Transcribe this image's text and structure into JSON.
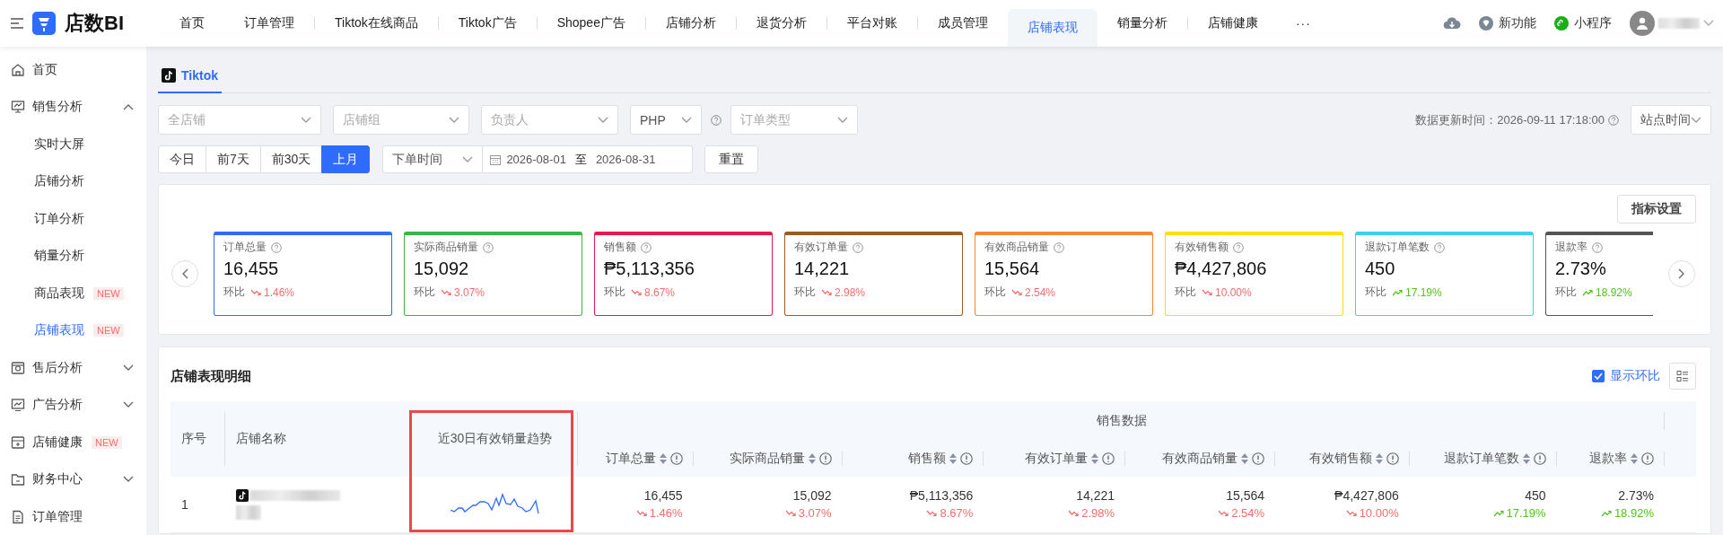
{
  "app": {
    "logo": "店数BI"
  },
  "nav": [
    {
      "label": "首页",
      "selected": false
    },
    {
      "label": "订单管理",
      "selected": false
    },
    {
      "label": "Tiktok在线商品",
      "selected": false
    },
    {
      "label": "Tiktok广告",
      "selected": false
    },
    {
      "label": "Shopee广告",
      "selected": false
    },
    {
      "label": "店铺分析",
      "selected": false
    },
    {
      "label": "退货分析",
      "selected": false
    },
    {
      "label": "平台对账",
      "selected": false
    },
    {
      "label": "成员管理",
      "selected": false
    },
    {
      "label": "店铺表现",
      "selected": true
    },
    {
      "label": "销量分析",
      "selected": false
    },
    {
      "label": "店铺健康",
      "selected": false
    }
  ],
  "nav_more": "···",
  "header_actions": [
    {
      "kind": "download"
    },
    {
      "kind": "features",
      "label": "新功能"
    },
    {
      "kind": "miniapp",
      "label": "小程序"
    }
  ],
  "sidebar": {
    "items": [
      {
        "kind": "home",
        "label": "首页",
        "selected": false
      },
      {
        "kind": "board",
        "label": "销售分析",
        "selected": false,
        "expanded": true,
        "children": [
          {
            "label": "实时大屏",
            "selected": false
          },
          {
            "label": "店铺分析",
            "selected": false
          },
          {
            "label": "订单分析",
            "selected": false
          },
          {
            "label": "销量分析",
            "selected": false
          },
          {
            "label": "商品表现",
            "selected": false,
            "badge": "NEW"
          },
          {
            "label": "店铺表现",
            "selected": true,
            "badge": "NEW"
          }
        ]
      },
      {
        "kind": "aftersale",
        "label": "售后分析",
        "selected": false,
        "expanded": false
      },
      {
        "kind": "ad",
        "label": "广告分析",
        "selected": false,
        "expanded": false
      },
      {
        "kind": "store",
        "label": "店铺健康",
        "selected": false,
        "badge": "NEW"
      },
      {
        "kind": "finance",
        "label": "财务中心",
        "selected": false,
        "expanded": false
      },
      {
        "kind": "document",
        "label": "订单管理",
        "selected": false
      }
    ]
  },
  "platform_tabs": [
    {
      "label": "Tiktok",
      "selected": true
    }
  ],
  "filters": [
    {
      "placeholder": "全店铺"
    },
    {
      "placeholder": "店铺组"
    },
    {
      "placeholder": "负责人"
    }
  ],
  "currency": {
    "value": "PHP"
  },
  "order_type": {
    "placeholder": "订单类型"
  },
  "update_time": "数据更新时间：2026-09-11 17:18:00",
  "timezone": {
    "value": "站点时间"
  },
  "quick_ranges": [
    {
      "label": "今日",
      "selected": false
    },
    {
      "label": "前7天",
      "selected": false
    },
    {
      "label": "前30天",
      "selected": false
    },
    {
      "label": "上月",
      "selected": true
    }
  ],
  "date_filter": {
    "type": "下单时间",
    "start": "2026-08-01",
    "separator": "至",
    "end": "2026-08-31"
  },
  "reset_button": "重置",
  "metrics_button": "指标设置",
  "cards": [
    {
      "label": "订单总量",
      "value": "16,455",
      "compare_label": "环比",
      "change": "1.46%",
      "rising": false,
      "color": "#2f6bff"
    },
    {
      "label": "实际商品销量",
      "value": "15,092",
      "compare_label": "环比",
      "change": "3.07%",
      "rising": false,
      "color": "#3bb346"
    },
    {
      "label": "销售额",
      "value": "₱5,113,356",
      "compare_label": "环比",
      "change": "8.67%",
      "rising": false,
      "color": "#e8194a"
    },
    {
      "label": "有效订单量",
      "value": "14,221",
      "compare_label": "环比",
      "change": "2.98%",
      "rising": false,
      "color": "#9a5c1f"
    },
    {
      "label": "有效商品销量",
      "value": "15,564",
      "compare_label": "环比",
      "change": "2.54%",
      "rising": false,
      "color": "#f58634"
    },
    {
      "label": "有效销售额",
      "value": "₱4,427,806",
      "compare_label": "环比",
      "change": "10.00%",
      "rising": false,
      "color": "#ffdf00"
    },
    {
      "label": "退款订单笔数",
      "value": "450",
      "compare_label": "环比",
      "change": "17.19%",
      "rising": true,
      "color": "#3ad0f0"
    },
    {
      "label": "退款率",
      "value": "2.73%",
      "compare_label": "环比",
      "change": "18.92%",
      "rising": true,
      "color": "#555555"
    }
  ],
  "table": {
    "title": "店铺表现明细",
    "show_compare": {
      "label": "显示环比",
      "checked": true
    },
    "fixed_columns": [
      "序号",
      "店铺名称",
      "近30日有效销量趋势"
    ],
    "group_header": "销售数据",
    "columns": [
      "订单总量",
      "实际商品销量",
      "销售额",
      "有效订单量",
      "有效商品销量",
      "有效销售额",
      "退款订单笔数",
      "退款率"
    ],
    "rows": [
      {
        "index": "1",
        "cells": [
          {
            "value": "16,455",
            "change": "1.46%",
            "rising": false
          },
          {
            "value": "15,092",
            "change": "3.07%",
            "rising": false
          },
          {
            "value": "₱5,113,356",
            "change": "8.67%",
            "rising": false
          },
          {
            "value": "14,221",
            "change": "2.98%",
            "rising": false
          },
          {
            "value": "15,564",
            "change": "2.54%",
            "rising": false
          },
          {
            "value": "₱4,427,806",
            "change": "10.00%",
            "rising": false
          },
          {
            "value": "450",
            "change": "17.19%",
            "rising": true
          },
          {
            "value": "2.73%",
            "change": "18.92%",
            "rising": true
          }
        ]
      }
    ]
  }
}
